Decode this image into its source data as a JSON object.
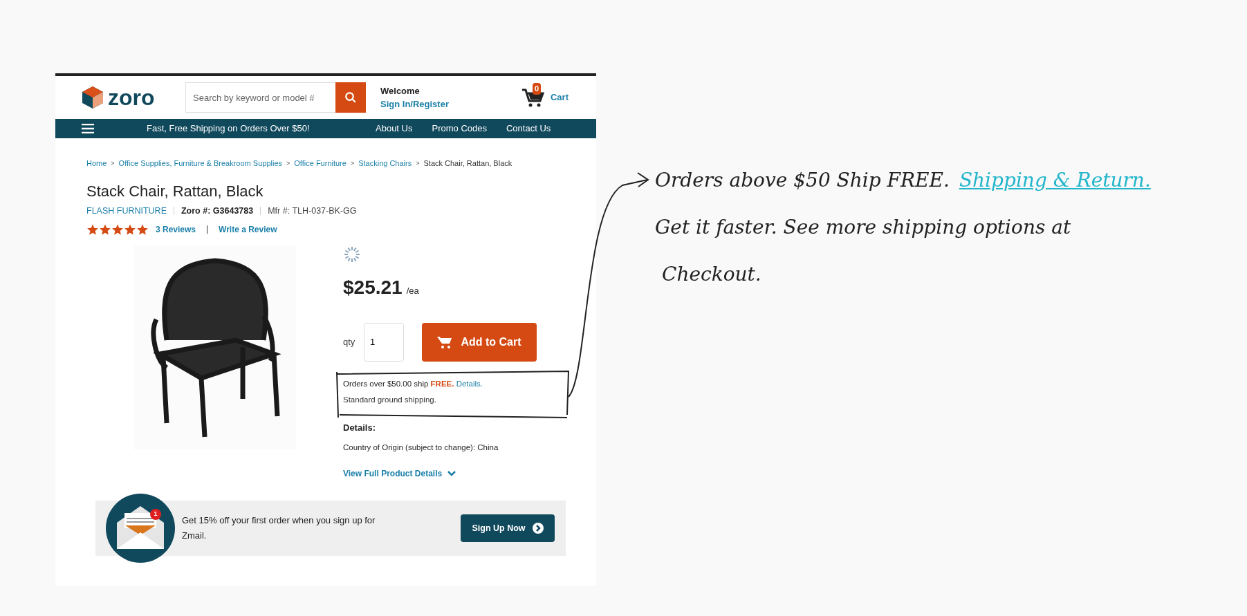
{
  "header": {
    "logo": "zoro",
    "search": {
      "placeholder": "Search by keyword or model #"
    },
    "welcome": "Welcome",
    "sign_in": "Sign In/Register",
    "cart_count": "0",
    "cart_label": "Cart"
  },
  "nav": {
    "promo": "Fast, Free Shipping on Orders Over $50!",
    "links": [
      "About Us",
      "Promo Codes",
      "Contact Us"
    ]
  },
  "breadcrumb": {
    "separator": ">",
    "items": [
      {
        "label": "Home",
        "link": true
      },
      {
        "label": "Office Supplies, Furniture & Breakroom Supplies",
        "link": true
      },
      {
        "label": "Office Furniture",
        "link": true
      },
      {
        "label": "Stacking Chairs",
        "link": true
      },
      {
        "label": "Stack Chair, Rattan, Black",
        "link": false
      }
    ]
  },
  "product": {
    "title": "Stack Chair, Rattan, Black",
    "brand": "FLASH FURNITURE",
    "zoro_number": "Zoro #: G3643783",
    "mfr_number": "Mfr #: TLH-037-BK-GG",
    "stars": 5,
    "reviews": "3 Reviews",
    "write_review": "Write a Review",
    "price": "$25.21",
    "unit": "/ea",
    "qty_label": "qty",
    "qty": "1",
    "add_to_cart": "Add to Cart",
    "shipping": {
      "text": "Orders over $50.00 ship",
      "free": "FREE.",
      "details_link": "Details.",
      "note": "Standard ground shipping."
    },
    "details_heading": "Details:",
    "origin": "Country of Origin (subject to change): China",
    "view_details": "View Full Product Details"
  },
  "banner": {
    "badge": "1",
    "text": "Get 15% off your first order when you sign up for Zmail.",
    "button": "Sign Up Now"
  },
  "annotation": {
    "line_1": "Orders above $50 Ship FREE.",
    "link": "Shipping & Return.",
    "line_2": "Get it faster. See more shipping options at",
    "line_3": "Checkout."
  }
}
